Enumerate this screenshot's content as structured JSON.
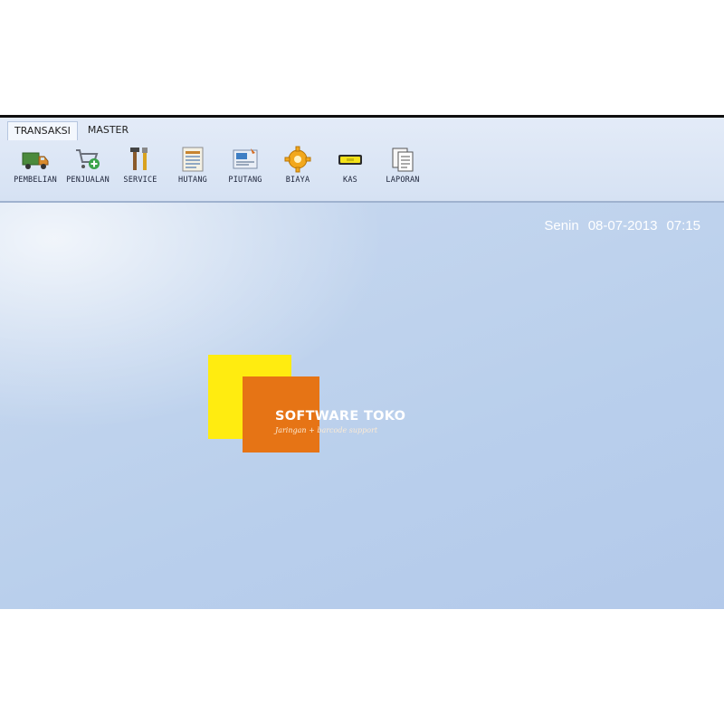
{
  "tabs": [
    {
      "label": "TRANSAKSI",
      "active": true
    },
    {
      "label": "MASTER",
      "active": false
    }
  ],
  "toolbar": [
    {
      "label": "PEMBELIAN",
      "icon": "truck-icon"
    },
    {
      "label": "PENJUALAN",
      "icon": "cart-add-icon"
    },
    {
      "label": "SERVICE",
      "icon": "tools-icon"
    },
    {
      "label": "HUTANG",
      "icon": "ledger-icon"
    },
    {
      "label": "PIUTANG",
      "icon": "receivable-icon"
    },
    {
      "label": "BIAYA",
      "icon": "gear-icon"
    },
    {
      "label": "KAS",
      "icon": "cash-drawer-icon"
    },
    {
      "label": "LAPORAN",
      "icon": "report-icon"
    }
  ],
  "status": {
    "day": "Senin",
    "date": "08-07-2013",
    "time": "07:15"
  },
  "logo": {
    "title": "SOFTWARE TOKO",
    "subtitle": "Jaringan + barcode support"
  },
  "colors": {
    "yellow": "#ffec10",
    "orange": "#e67415",
    "background": "#c3d5ee"
  }
}
